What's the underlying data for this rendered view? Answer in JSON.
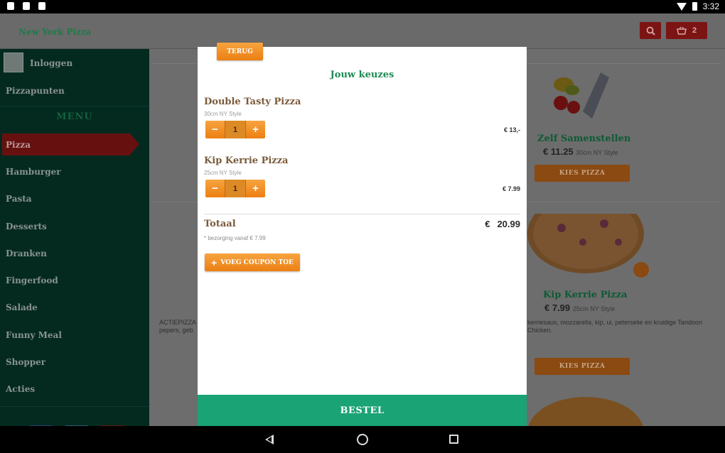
{
  "status_bar": {
    "time": "3:32"
  },
  "app": {
    "title": "New York Pizza",
    "cart_count": "2"
  },
  "sidebar": {
    "login_label": "Inloggen",
    "points_label": "Pizzapunten",
    "menu_heading": "MENU",
    "items": [
      {
        "label": "Pizza"
      },
      {
        "label": "Hamburger"
      },
      {
        "label": "Pasta"
      },
      {
        "label": "Desserts"
      },
      {
        "label": "Dranken"
      },
      {
        "label": "Fingerfood"
      },
      {
        "label": "Salade"
      },
      {
        "label": "Funny Meal"
      },
      {
        "label": "Shopper"
      },
      {
        "label": "Acties"
      }
    ]
  },
  "background": {
    "card1": {
      "title": "Zelf Samenstellen",
      "price": "€ 11.25",
      "size": "30cm NY Style",
      "button": "KIES PIZZA"
    },
    "card2": {
      "title": "Kip Kerrie Pizza",
      "price": "€ 7.99",
      "size": "25cm NY Style",
      "desc": "kerriesaus, mozzarella, kip, ui, peterselie en kruidige Tandoori Chicken.",
      "button": "KIES PIZZA"
    },
    "left_desc": "ACTIEPIZZA\npepers, geb"
  },
  "modal": {
    "back_label": "TERUG",
    "title": "Jouw keuzes",
    "items": [
      {
        "name": "Double Tasty Pizza",
        "size": "30cm NY Style",
        "qty": "1",
        "price": "€ 13,-"
      },
      {
        "name": "Kip Kerrie Pizza",
        "size": "25cm NY Style",
        "qty": "1",
        "price": "€ 7.99"
      }
    ],
    "total_label": "Totaal",
    "total_currency": "€",
    "total_value": "20.99",
    "delivery_note": "* bezorging vanaf € 7.99",
    "coupon_button": "VOEG COUPON TOE",
    "order_button": "BESTEL"
  }
}
